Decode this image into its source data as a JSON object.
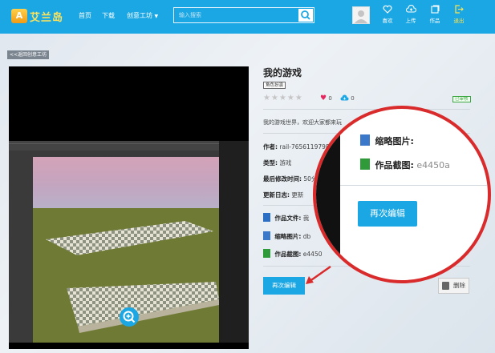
{
  "header": {
    "logo_text": "艾兰岛",
    "nav": [
      "首页",
      "下载",
      "创意工坊"
    ],
    "search_placeholder": "输入搜索",
    "actions": [
      {
        "label": "喜欢",
        "icon": "heart-outline-icon"
      },
      {
        "label": "上传",
        "icon": "cloud-upload-icon"
      },
      {
        "label": "作品",
        "icon": "works-icon"
      },
      {
        "label": "退出",
        "icon": "exit-icon"
      }
    ]
  },
  "back_link": "<<返回创意工坊",
  "work": {
    "title": "我的游戏",
    "tag": "角色扮演",
    "rating": 0,
    "likes": "0",
    "downloads": "0",
    "status": "已审核",
    "description": "我的游戏世界，欢迎大家都来玩",
    "author_label": "作者:",
    "author_value": "rail-76561197980265",
    "type_label": "类型:",
    "type_value": "游戏",
    "modified_label": "最后修改时间:",
    "modified_value": "50分",
    "changelog_label": "更新日志:",
    "changelog_value": "更新",
    "file_label": "作品文件:",
    "file_value": "我",
    "thumb_label": "缩略图片:",
    "thumb_value": "db",
    "shot_label": "作品截图:",
    "shot_value": "e4450"
  },
  "buttons": {
    "reedit": "再次编辑",
    "delete": "删除"
  },
  "magnifier": {
    "thumb_label": "缩略图片:",
    "shot_label": "作品截图:",
    "shot_value": "e4450a",
    "button": "再次编辑"
  },
  "colors": {
    "brand": "#1ba7e3",
    "highlight": "#d92b2b",
    "status_green": "#3aa640",
    "like_pink": "#e2285e"
  }
}
